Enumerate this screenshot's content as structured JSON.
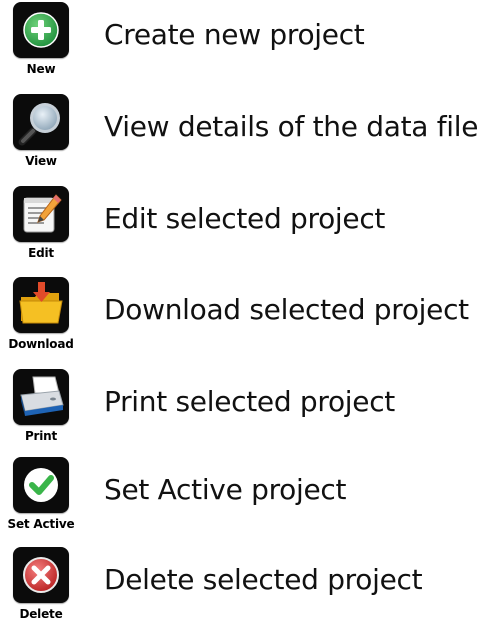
{
  "actions": [
    {
      "key": "new",
      "label": "New",
      "description": "Create new project",
      "icon": "plus-circle-icon",
      "color": "#2fa84f"
    },
    {
      "key": "view",
      "label": "View",
      "description": "View details of the data file",
      "icon": "magnifier-icon",
      "color": "#8fa6b8"
    },
    {
      "key": "edit",
      "label": "Edit",
      "description": "Edit selected project",
      "icon": "notepad-pencil-icon",
      "color": "#f2a23a"
    },
    {
      "key": "download",
      "label": "Download",
      "description": "Download selected project",
      "icon": "folder-download-icon",
      "color": "#f5c023"
    },
    {
      "key": "print",
      "label": "Print",
      "description": "Print selected project",
      "icon": "printer-icon",
      "color": "#1e63b5"
    },
    {
      "key": "set_active",
      "label": "Set Active",
      "description": "Set Active project",
      "icon": "checkmark-circle-icon",
      "color": "#3ab54a"
    },
    {
      "key": "delete",
      "label": "Delete",
      "description": "Delete selected project",
      "icon": "x-circle-icon",
      "color": "#d63b3b"
    }
  ]
}
